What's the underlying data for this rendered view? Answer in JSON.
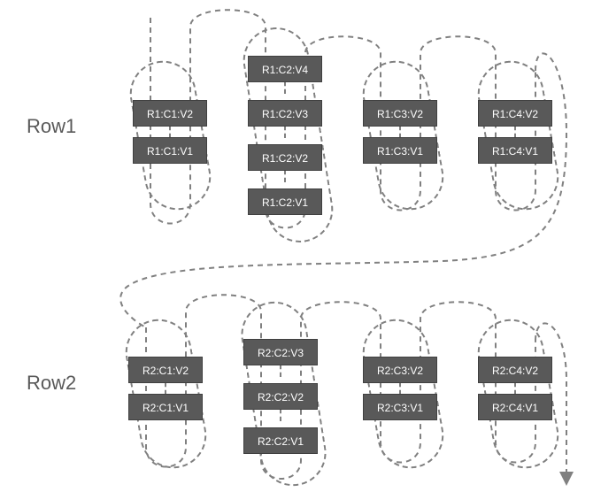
{
  "labels": {
    "row1": "Row1",
    "row2": "Row2"
  },
  "cells": {
    "r1c1v2": "R1:C1:V2",
    "r1c1v1": "R1:C1:V1",
    "r1c2v4": "R1:C2:V4",
    "r1c2v3": "R1:C2:V3",
    "r1c2v2": "R1:C2:V2",
    "r1c2v1": "R1:C2:V1",
    "r1c3v2": "R1:C3:V2",
    "r1c3v1": "R1:C3:V1",
    "r1c4v2": "R1:C4:V2",
    "r1c4v1": "R1:C4:V1",
    "r2c1v2": "R2:C1:V2",
    "r2c1v1": "R2:C1:V1",
    "r2c2v3": "R2:C2:V3",
    "r2c2v2": "R2:C2:V2",
    "r2c2v1": "R2:C2:V1",
    "r2c3v2": "R2:C3:V2",
    "r2c3v1": "R2:C3:V1",
    "r2c4v2": "R2:C4:V2",
    "r2c4v1": "R2:C4:V1"
  },
  "colors": {
    "stroke": "#808080",
    "text": "#595959",
    "cellFill": "#595959",
    "cellText": "#ffffff"
  }
}
